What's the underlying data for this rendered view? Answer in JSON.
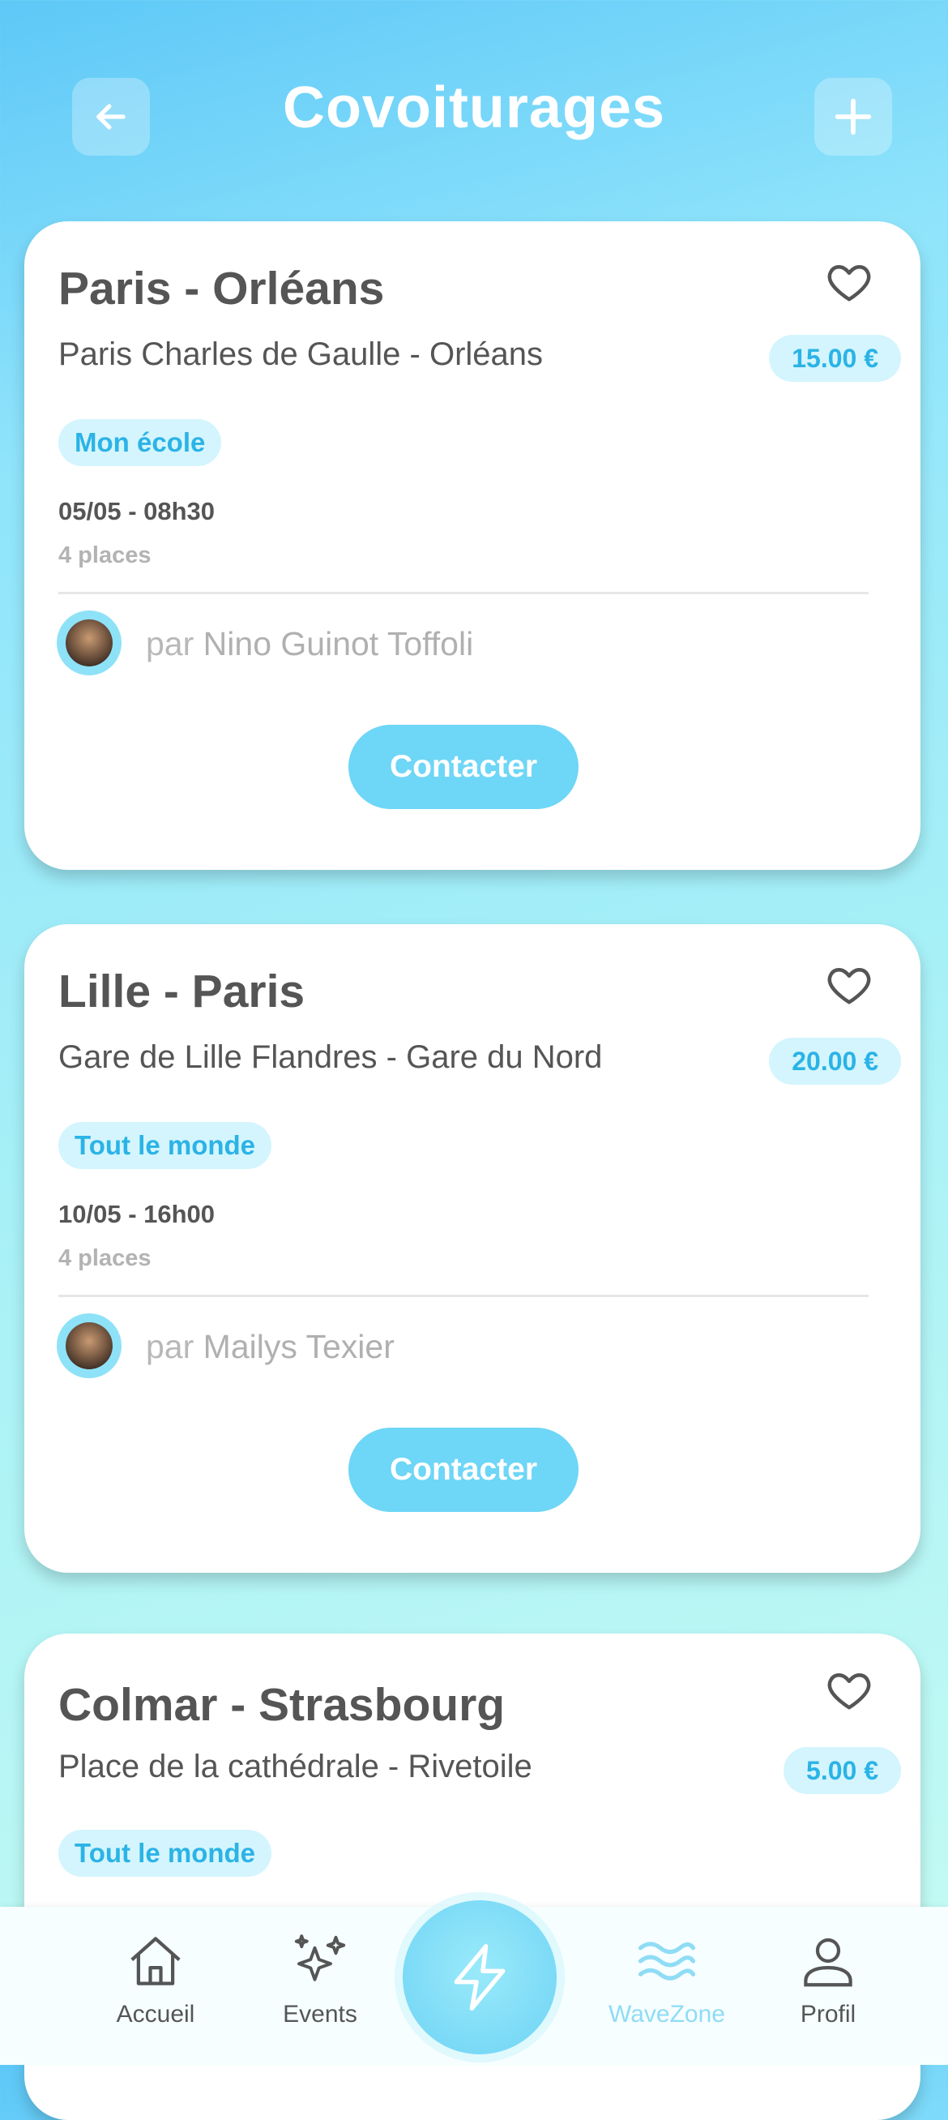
{
  "header": {
    "title": "Covoiturages",
    "back_icon": "arrow-left-icon",
    "add_icon": "plus-icon"
  },
  "rides": [
    {
      "route": "Paris - Orléans",
      "stops": "Paris Charles de Gaulle - Orléans",
      "price": "15.00 €",
      "audience": "Mon école",
      "datetime": "05/05  -  08h30",
      "seats": "4 places",
      "by_prefix": "par",
      "driver": "Nino Guinot Toffoli",
      "contact_label": "Contacter"
    },
    {
      "route": "Lille - Paris",
      "stops": "Gare de Lille Flandres - Gare du Nord",
      "price": "20.00 €",
      "audience": "Tout le monde",
      "datetime": "10/05  -  16h00",
      "seats": "4 places",
      "by_prefix": "par",
      "driver": "Mailys Texier",
      "contact_label": "Contacter"
    },
    {
      "route": "Colmar - Strasbourg",
      "stops": "Place de la cathédrale - Rivetoile",
      "price": "5.00 €",
      "audience": "Tout le monde"
    }
  ],
  "nav": {
    "items": [
      {
        "label": "Accueil",
        "icon": "home-icon"
      },
      {
        "label": "Events",
        "icon": "sparkles-icon"
      },
      {
        "label": "WaveZone",
        "icon": "waves-icon",
        "active": true
      },
      {
        "label": "Profil",
        "icon": "user-icon"
      }
    ],
    "center_icon": "lightning-icon"
  },
  "colors": {
    "accent": "#6ed6f6",
    "tag_bg": "#d4f5fd",
    "tag_text": "#2bb3e6",
    "text": "#555555",
    "muted": "#b3b3b3"
  }
}
